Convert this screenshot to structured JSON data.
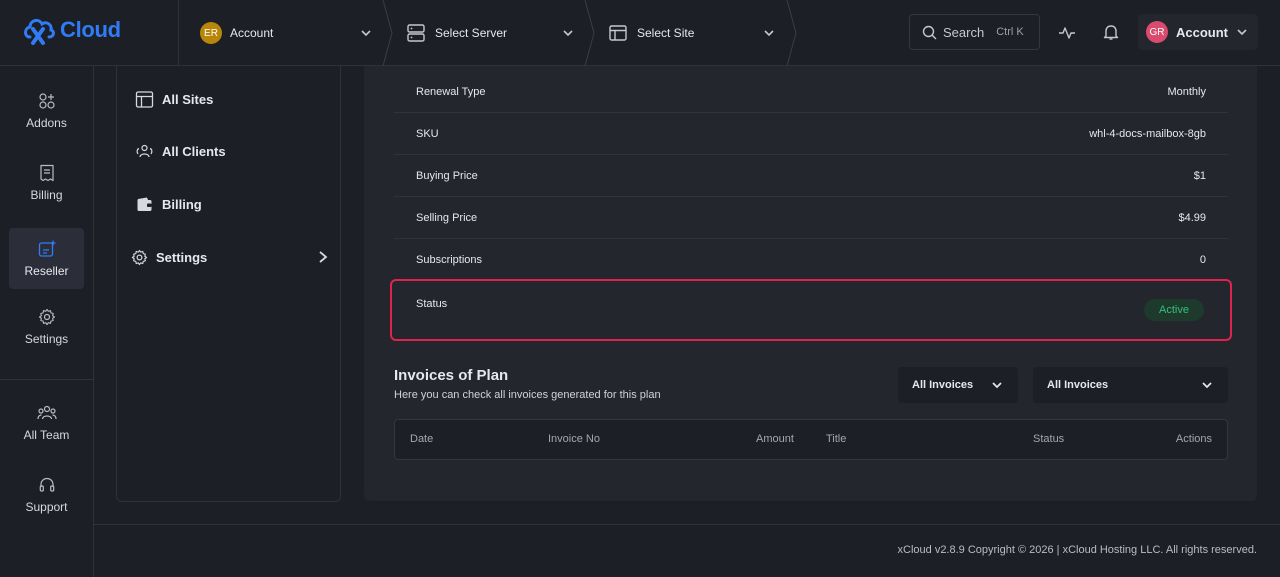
{
  "brand": {
    "logo_text": "Cloud",
    "logo_mark": "x"
  },
  "topbar": {
    "team_initials": "ER",
    "team_label": "Account",
    "server_label": "Select Server",
    "site_label": "Select Site",
    "search_label": "Search",
    "search_shortcut": "Ctrl K",
    "account_initials": "GR",
    "account_label": "Account"
  },
  "rail": {
    "items": [
      {
        "label": "Addons",
        "icon": "addons-icon"
      },
      {
        "label": "Billing",
        "icon": "receipt-icon"
      },
      {
        "label": "Reseller",
        "icon": "reseller-icon",
        "active": true
      },
      {
        "label": "Settings",
        "icon": "gear-icon"
      },
      {
        "label": "All Team",
        "icon": "team-icon"
      },
      {
        "label": "Support",
        "icon": "headset-icon"
      }
    ]
  },
  "subnav": {
    "items": [
      {
        "label": "All Sites",
        "icon": "browser-icon"
      },
      {
        "label": "All Clients",
        "icon": "clients-icon"
      },
      {
        "label": "Billing",
        "icon": "wallet-icon"
      },
      {
        "label": "Settings",
        "icon": "gear-icon"
      }
    ]
  },
  "details": {
    "rows": [
      {
        "key": "Renewal Type",
        "value": "Monthly"
      },
      {
        "key": "SKU",
        "value": "whl-4-docs-mailbox-8gb"
      },
      {
        "key": "Buying Price",
        "value": "$1"
      },
      {
        "key": "Selling Price",
        "value": "$4.99"
      },
      {
        "key": "Subscriptions",
        "value": "0"
      }
    ],
    "status_key": "Status",
    "status_value": "Active"
  },
  "invoices": {
    "title": "Invoices of Plan",
    "subtitle": "Here you can check all invoices generated for this plan",
    "filter1": "All Invoices",
    "filter2": "All Invoices",
    "columns": [
      "Date",
      "Invoice No",
      "Amount",
      "Title",
      "Status",
      "Actions"
    ]
  },
  "footer": {
    "text": "xCloud v2.8.9 Copyright © 2026 | xCloud Hosting LLC. All rights reserved."
  },
  "colors": {
    "accent": "#2f7cf6",
    "highlight": "#e0234e",
    "active_green": "#33c07a"
  }
}
